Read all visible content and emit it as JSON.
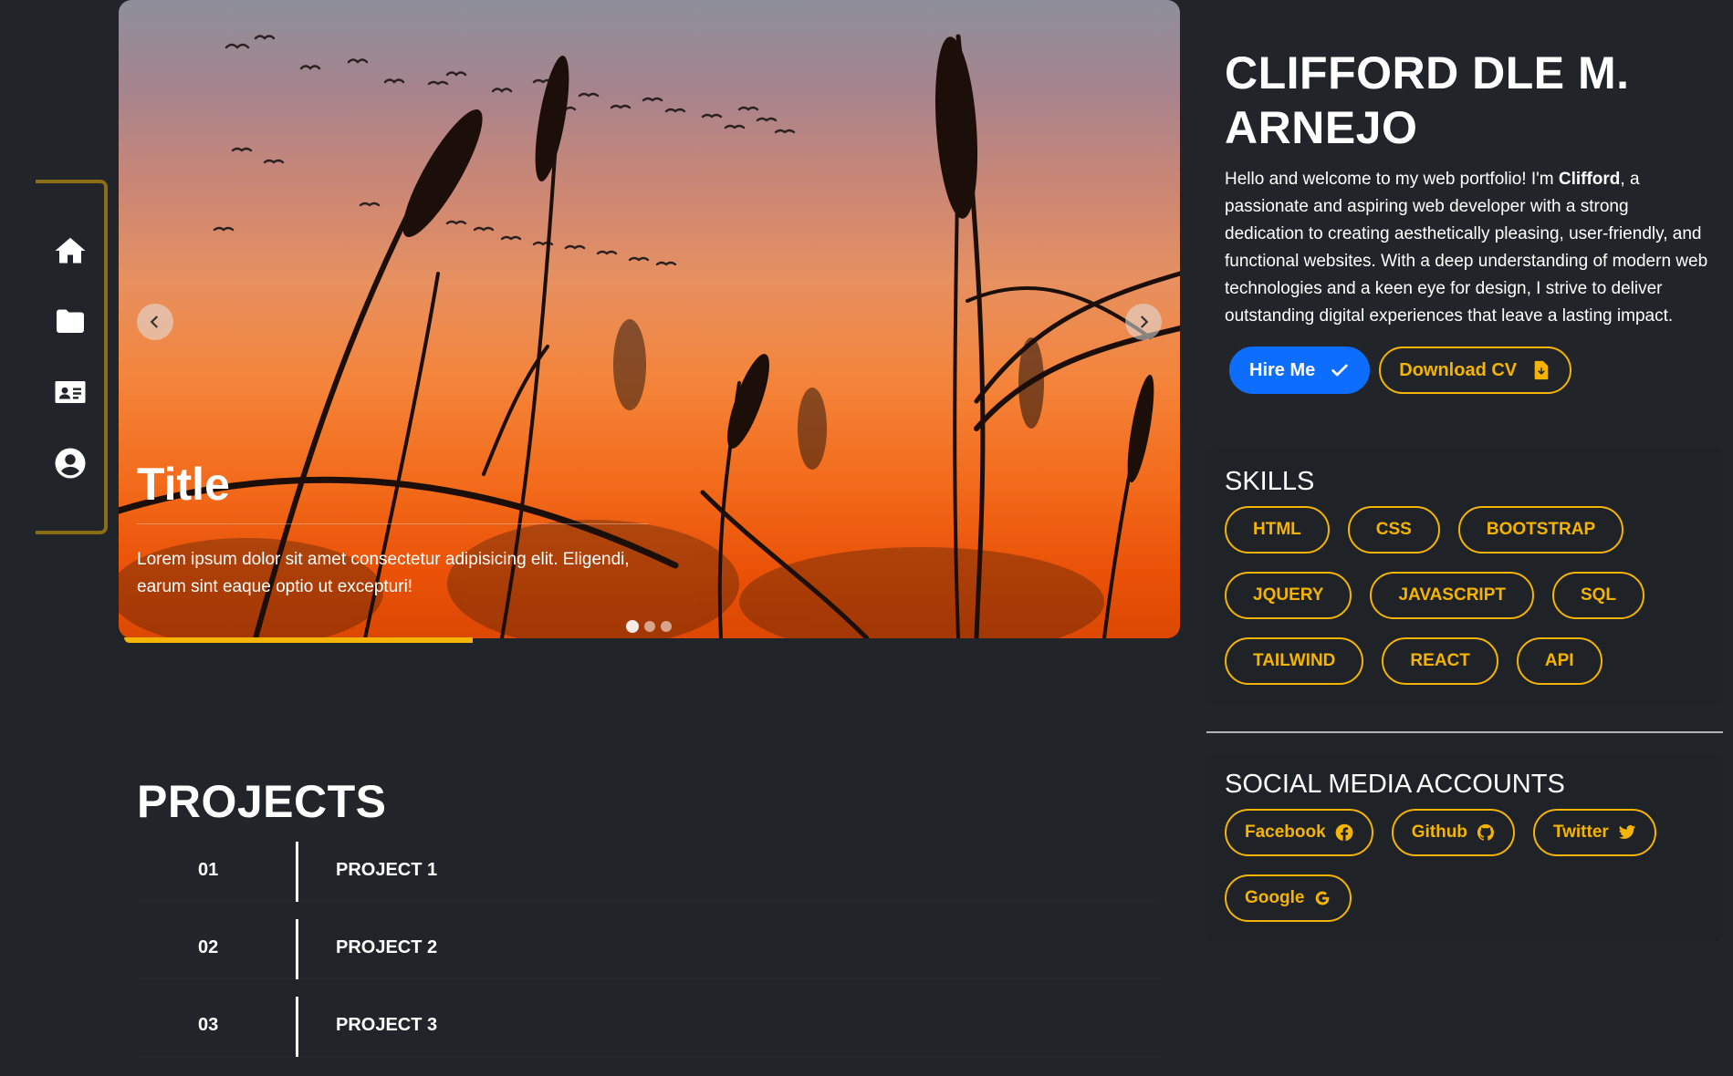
{
  "nav": {
    "items": [
      {
        "name": "home",
        "icon": "home-icon"
      },
      {
        "name": "projects",
        "icon": "folder-icon"
      },
      {
        "name": "contact",
        "icon": "address-card-icon"
      },
      {
        "name": "profile",
        "icon": "user-circle-icon"
      }
    ]
  },
  "carousel": {
    "caption_title": "Title",
    "caption_text": "Lorem ipsum dolor sit amet consectetur adipisicing elit. Eligendi, earum sint eaque optio ut excepturi!",
    "slides": 3,
    "active_slide": 1,
    "progress": 0.33
  },
  "projects": {
    "title": "PROJECTS",
    "items": [
      {
        "num": "01",
        "name": "PROJECT 1"
      },
      {
        "num": "02",
        "name": "PROJECT 2"
      },
      {
        "num": "03",
        "name": "PROJECT 3"
      }
    ]
  },
  "profile": {
    "name": "CLIFFORD DLE M. ARNEJO",
    "bio_intro": "Hello and welcome to my web portfolio! I'm ",
    "bio_name": "Clifford",
    "bio_rest": ", a passionate and aspiring web developer with a strong dedication to creating aesthetically pleasing, user-friendly, and functional websites. With a deep understanding of modern web technologies and a keen eye for design, I strive to deliver outstanding digital experiences that leave a lasting impact.",
    "hire_label": "Hire Me",
    "download_label": "Download CV"
  },
  "skills": {
    "title": "SKILLS",
    "items": [
      "HTML",
      "CSS",
      "BOOTSTRAP",
      "JQUERY",
      "JAVASCRIPT",
      "SQL",
      "TAILWIND",
      "REACT",
      "API"
    ]
  },
  "social": {
    "title": "SOCIAL MEDIA ACCOUNTS",
    "items": [
      {
        "label": "Facebook",
        "icon": "facebook-icon"
      },
      {
        "label": "Github",
        "icon": "github-icon"
      },
      {
        "label": "Twitter",
        "icon": "twitter-icon"
      },
      {
        "label": "Google",
        "icon": "google-icon"
      }
    ]
  },
  "colors": {
    "background": "#212529",
    "accent": "#f5b400",
    "primary": "#0d6efd"
  }
}
